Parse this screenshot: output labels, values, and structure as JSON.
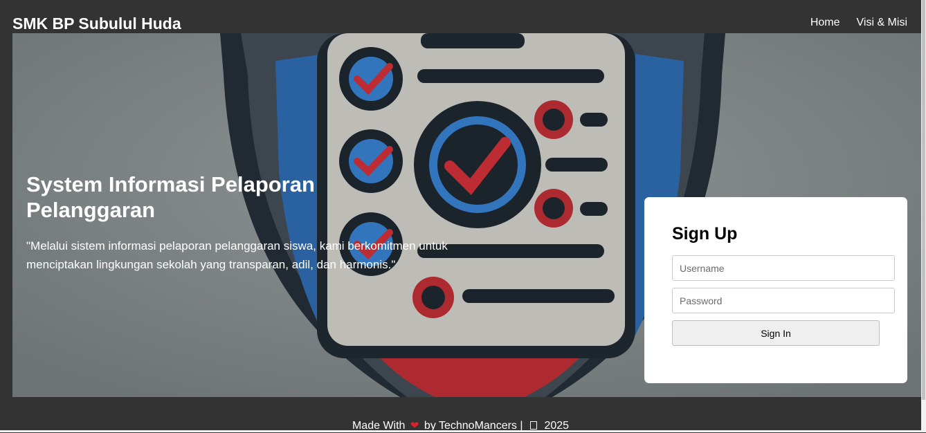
{
  "header": {
    "brand": "SMK BP Subulul Huda",
    "nav": [
      {
        "label": "Home"
      },
      {
        "label": "Visi & Misi"
      }
    ]
  },
  "hero": {
    "title": "System Informasi Pelaporan Pelanggaran",
    "quote": "\"Melalui sistem informasi pelaporan pelanggaran siswa, kami berkomitmen untuk menciptakan lingkungan sekolah yang transparan, adil, dan harmonis.\""
  },
  "signup": {
    "title": "Sign Up",
    "username_placeholder": "Username",
    "password_placeholder": "Password",
    "submit_label": "Sign In"
  },
  "footer": {
    "prefix": "Made With",
    "heart_icon": "heart-icon",
    "by": "by TechnoMancers |",
    "year": "2025"
  },
  "colors": {
    "background": "#333333",
    "accent_red": "#d8333b",
    "accent_blue": "#3a86d8"
  }
}
